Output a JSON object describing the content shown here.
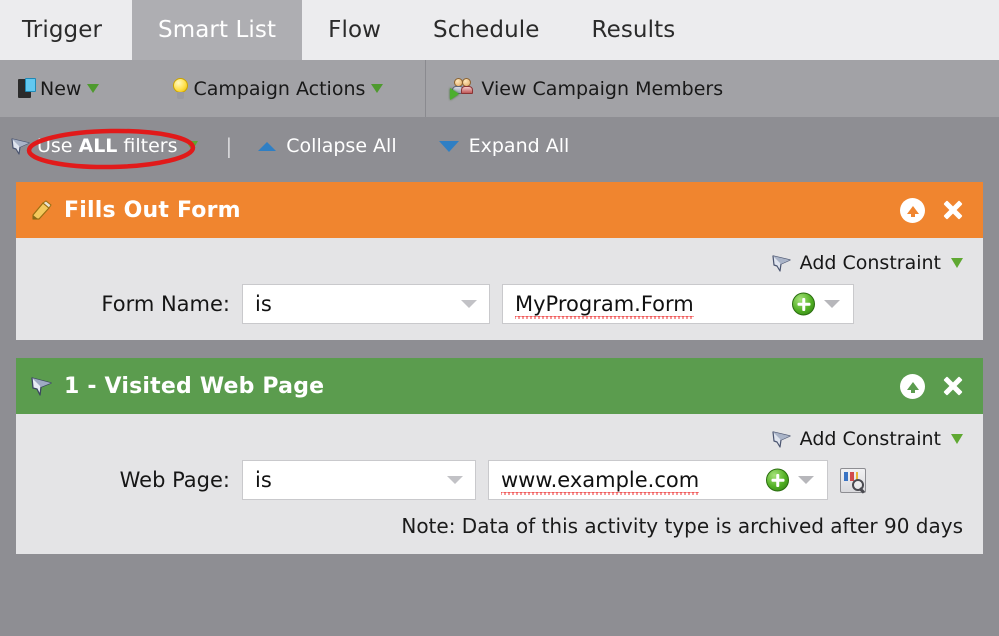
{
  "tabs": [
    {
      "label": "Trigger",
      "active": false
    },
    {
      "label": "Smart List",
      "active": true
    },
    {
      "label": "Flow",
      "active": false
    },
    {
      "label": "Schedule",
      "active": false
    },
    {
      "label": "Results",
      "active": false
    }
  ],
  "toolbar": {
    "new_label": "New",
    "new_icon": "document-icon",
    "campaign_actions_label": "Campaign Actions",
    "campaign_actions_icon": "lightbulb-icon",
    "view_members_label": "View Campaign Members",
    "view_members_icon": "users-icon"
  },
  "filterbar": {
    "use_all_filters_prefix": "Use ",
    "use_all_filters_strong": "ALL",
    "use_all_filters_suffix": " filters",
    "funnel_icon": "funnel-icon",
    "separator": "|",
    "collapse_all_label": "Collapse All",
    "expand_all_label": "Expand All",
    "annotation": "red-ellipse-highlight"
  },
  "panels": [
    {
      "id": "fills-out-form",
      "title": "Fills Out Form",
      "header_color": "#f0852f",
      "header_icon": "pencil-form-icon",
      "add_constraint_label": "Add Constraint",
      "field": {
        "label": "Form Name:",
        "operator": "is",
        "value": "MyProgram.Form",
        "has_preview_icon": false
      },
      "note": null
    },
    {
      "id": "visited-web-page",
      "title": "1 - Visited Web Page",
      "header_color": "#5b9c4e",
      "header_icon": "funnel-icon",
      "add_constraint_label": "Add Constraint",
      "field": {
        "label": "Web Page:",
        "operator": "is",
        "value": "www.example.com",
        "has_preview_icon": true
      },
      "note": "Note: Data of this activity type is archived after 90 days"
    }
  ],
  "colors": {
    "page_background": "#8e8e93",
    "tab_inactive": "#ececee",
    "tab_active": "#aeaeb2",
    "toolbar": "#a2a2a6",
    "panel_body": "#e4e4e6",
    "orange_header": "#f0852f",
    "green_header": "#5b9c4e",
    "annotation_red": "#e11a1a",
    "accent_blue": "#2f7fc4",
    "accent_green": "#4e9a2e"
  }
}
